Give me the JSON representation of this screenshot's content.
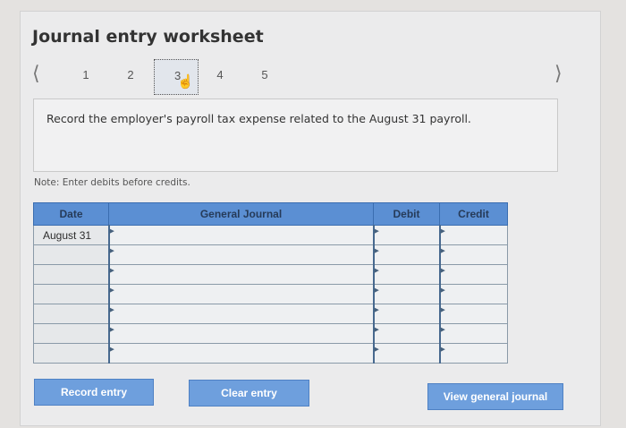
{
  "worksheet": {
    "title": "Journal entry worksheet",
    "steps": [
      "1",
      "2",
      "3",
      "4",
      "5"
    ],
    "active_step": "3",
    "prev_icon": "chevron-left-icon",
    "next_icon": "chevron-right-icon",
    "question": "Record the employer's payroll tax expense related to the August 31 payroll.",
    "note": "Note: Enter debits before credits."
  },
  "journal": {
    "headers": {
      "date": "Date",
      "account": "General Journal",
      "debit": "Debit",
      "credit": "Credit"
    },
    "rows": [
      {
        "date": "August 31",
        "account": "",
        "debit": "",
        "credit": ""
      },
      {
        "date": "",
        "account": "",
        "debit": "",
        "credit": ""
      },
      {
        "date": "",
        "account": "",
        "debit": "",
        "credit": ""
      },
      {
        "date": "",
        "account": "",
        "debit": "",
        "credit": ""
      },
      {
        "date": "",
        "account": "",
        "debit": "",
        "credit": ""
      },
      {
        "date": "",
        "account": "",
        "debit": "",
        "credit": ""
      },
      {
        "date": "",
        "account": "",
        "debit": "",
        "credit": ""
      }
    ]
  },
  "buttons": {
    "record": "Record entry",
    "clear": "Clear entry",
    "view": "View general journal"
  },
  "colors": {
    "accent": "#6e9fdd",
    "header": "#5b8fd3"
  }
}
